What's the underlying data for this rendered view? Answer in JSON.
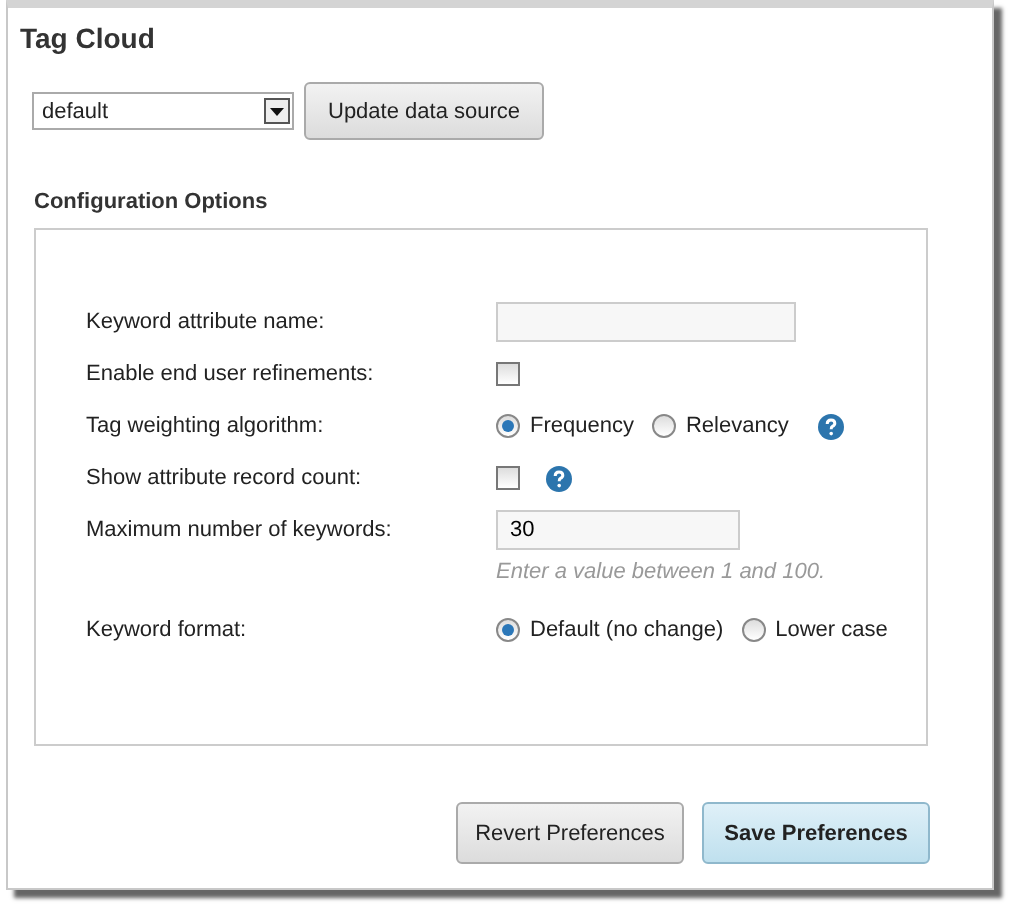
{
  "title": "Tag Cloud",
  "data_source": {
    "select_value": "default",
    "update_button": "Update data source"
  },
  "config": {
    "heading": "Configuration Options",
    "options": [
      {
        "kind": "text",
        "label": "Keyword attribute name:"
      },
      {
        "kind": "checkbox",
        "label": "Enable end user refinements:",
        "checked": false
      },
      {
        "kind": "radio",
        "label": "Tag weighting algorithm:",
        "help": true,
        "choices": [
          {
            "label": "Frequency",
            "selected": true
          },
          {
            "label": "Relevancy",
            "selected": false
          }
        ]
      },
      {
        "kind": "checkbox",
        "label": "Show attribute record count:",
        "checked": false,
        "help": true
      },
      {
        "kind": "text",
        "label": "Maximum number of keywords:",
        "value": "30",
        "hint": "Enter a value between 1 and 100."
      },
      {
        "kind": "radio",
        "label": "Keyword format:",
        "choices": [
          {
            "label": "Default (no change)",
            "selected": true
          },
          {
            "label": "Lower case",
            "selected": false
          }
        ]
      }
    ]
  },
  "buttons": [
    {
      "label": "Revert Preferences",
      "primary": false
    },
    {
      "label": "Save Preferences",
      "primary": true
    }
  ]
}
